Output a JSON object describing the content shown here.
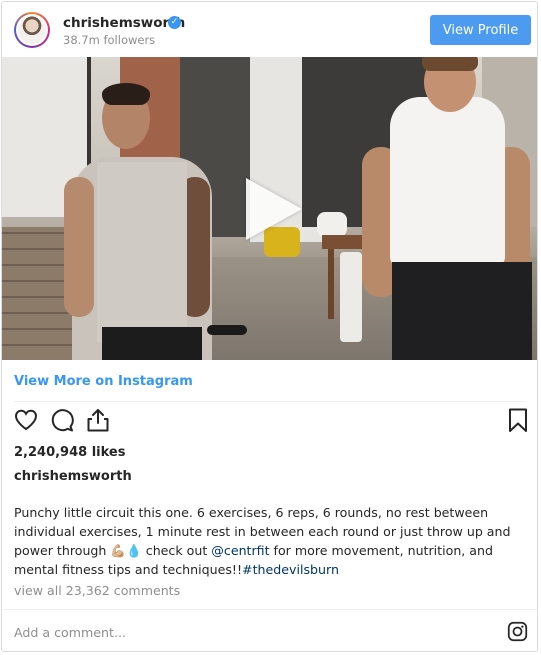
{
  "header": {
    "username": "chrishemsworth",
    "verified_mark": "✓",
    "followers": "38.7m followers",
    "view_profile_label": "View Profile"
  },
  "media": {
    "type": "video",
    "play_icon": "play-icon"
  },
  "view_more_label": "View More on Instagram",
  "actions": {
    "icons": [
      "heart-icon",
      "comment-icon",
      "share-icon",
      "bookmark-icon"
    ]
  },
  "likes": "2,240,948 likes",
  "caption": {
    "username": "chrishemsworth",
    "text_before": "Punchy little circuit this one. 6 exercises, 6 reps, 6 rounds, no rest between individual exercises, 1 minute rest in between each round or just throw up and power through 💪🏼💧 check out ",
    "mention": "@centrfit",
    "text_after": " for more movement, nutrition, and mental fitness tips and techniques!!",
    "hashtag": "#thedevilsburn"
  },
  "comments_link": "view all 23,362 comments",
  "add_comment_placeholder": "Add a comment...",
  "colors": {
    "accent": "#3897f0",
    "button": "#4c9bf0",
    "muted": "#8e8e8e",
    "text": "#262626"
  }
}
